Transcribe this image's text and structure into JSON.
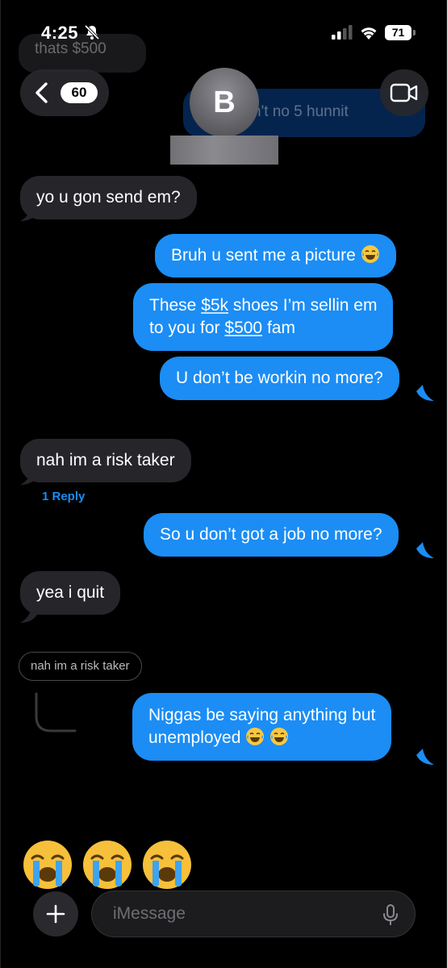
{
  "status_bar": {
    "time": "4:25",
    "battery": "71"
  },
  "ghost_messages": {
    "incoming": "thats $500",
    "outgoing": "n't no 5 hunnit"
  },
  "header": {
    "back_count": "60",
    "avatar_initial": "B"
  },
  "messages": [
    {
      "dir": "in",
      "text": "yo u gon send em?"
    },
    {
      "dir": "out",
      "text": "Bruh u sent me a picture"
    },
    {
      "dir": "out",
      "line1_a": "These ",
      "line1_link": "$5k",
      "line1_b": " shoes I’m sellin em",
      "line2_a": "to you for ",
      "line2_link": "$500",
      "line2_b": " fam"
    },
    {
      "dir": "out",
      "text": "U don’t be workin no more?"
    },
    {
      "dir": "in",
      "text": "nah im a risk taker"
    },
    {
      "dir": "out",
      "text": "So u don’t got a job no more?"
    },
    {
      "dir": "in",
      "text": "yea i quit"
    },
    {
      "dir": "out",
      "line1": "Niggas be saying anything but",
      "line2": "unemployed"
    }
  ],
  "reply_link": "1 Reply",
  "quoted_reply": "nah im a risk taker",
  "emoji_reactions": [
    "crying-face",
    "crying-face",
    "crying-face"
  ],
  "input": {
    "placeholder": "iMessage",
    "value": ""
  },
  "colors": {
    "outgoing_bubble": "#1b8df5",
    "incoming_bubble": "#26252a",
    "background": "#000000"
  }
}
